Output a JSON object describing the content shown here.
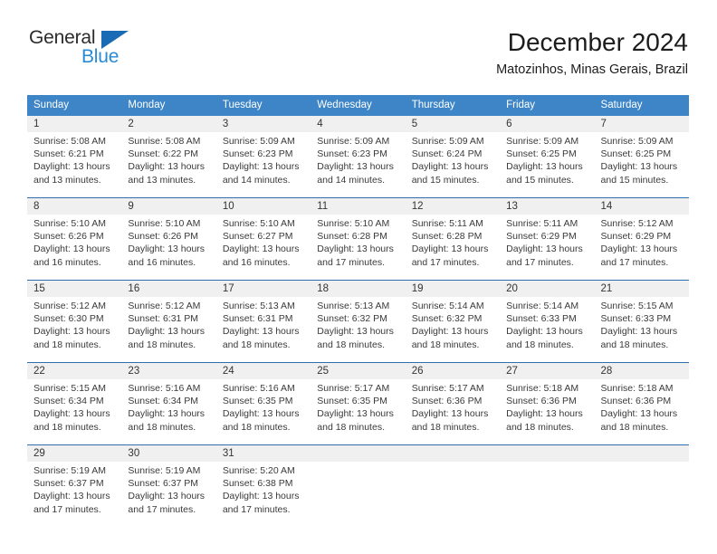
{
  "logo": {
    "word_top": "General",
    "word_bottom": "Blue",
    "triangle_icon": "triangle-icon",
    "color_dark": "#2b2b2b",
    "color_blue": "#2a8ad4",
    "color_triangle": "#1a6bb5"
  },
  "header": {
    "title": "December 2024",
    "subtitle": "Matozinhos, Minas Gerais, Brazil"
  },
  "theme": {
    "header_bg": "#3d85c6",
    "header_text": "#ffffff",
    "daynum_band_bg": "#f0f0f0",
    "row_divider": "#2f6fad"
  },
  "weekdays": [
    "Sunday",
    "Monday",
    "Tuesday",
    "Wednesday",
    "Thursday",
    "Friday",
    "Saturday"
  ],
  "weeks": [
    [
      {
        "day": "1",
        "sunrise": "Sunrise: 5:08 AM",
        "sunset": "Sunset: 6:21 PM",
        "daylight": "Daylight: 13 hours and 13 minutes."
      },
      {
        "day": "2",
        "sunrise": "Sunrise: 5:08 AM",
        "sunset": "Sunset: 6:22 PM",
        "daylight": "Daylight: 13 hours and 13 minutes."
      },
      {
        "day": "3",
        "sunrise": "Sunrise: 5:09 AM",
        "sunset": "Sunset: 6:23 PM",
        "daylight": "Daylight: 13 hours and 14 minutes."
      },
      {
        "day": "4",
        "sunrise": "Sunrise: 5:09 AM",
        "sunset": "Sunset: 6:23 PM",
        "daylight": "Daylight: 13 hours and 14 minutes."
      },
      {
        "day": "5",
        "sunrise": "Sunrise: 5:09 AM",
        "sunset": "Sunset: 6:24 PM",
        "daylight": "Daylight: 13 hours and 15 minutes."
      },
      {
        "day": "6",
        "sunrise": "Sunrise: 5:09 AM",
        "sunset": "Sunset: 6:25 PM",
        "daylight": "Daylight: 13 hours and 15 minutes."
      },
      {
        "day": "7",
        "sunrise": "Sunrise: 5:09 AM",
        "sunset": "Sunset: 6:25 PM",
        "daylight": "Daylight: 13 hours and 15 minutes."
      }
    ],
    [
      {
        "day": "8",
        "sunrise": "Sunrise: 5:10 AM",
        "sunset": "Sunset: 6:26 PM",
        "daylight": "Daylight: 13 hours and 16 minutes."
      },
      {
        "day": "9",
        "sunrise": "Sunrise: 5:10 AM",
        "sunset": "Sunset: 6:26 PM",
        "daylight": "Daylight: 13 hours and 16 minutes."
      },
      {
        "day": "10",
        "sunrise": "Sunrise: 5:10 AM",
        "sunset": "Sunset: 6:27 PM",
        "daylight": "Daylight: 13 hours and 16 minutes."
      },
      {
        "day": "11",
        "sunrise": "Sunrise: 5:10 AM",
        "sunset": "Sunset: 6:28 PM",
        "daylight": "Daylight: 13 hours and 17 minutes."
      },
      {
        "day": "12",
        "sunrise": "Sunrise: 5:11 AM",
        "sunset": "Sunset: 6:28 PM",
        "daylight": "Daylight: 13 hours and 17 minutes."
      },
      {
        "day": "13",
        "sunrise": "Sunrise: 5:11 AM",
        "sunset": "Sunset: 6:29 PM",
        "daylight": "Daylight: 13 hours and 17 minutes."
      },
      {
        "day": "14",
        "sunrise": "Sunrise: 5:12 AM",
        "sunset": "Sunset: 6:29 PM",
        "daylight": "Daylight: 13 hours and 17 minutes."
      }
    ],
    [
      {
        "day": "15",
        "sunrise": "Sunrise: 5:12 AM",
        "sunset": "Sunset: 6:30 PM",
        "daylight": "Daylight: 13 hours and 18 minutes."
      },
      {
        "day": "16",
        "sunrise": "Sunrise: 5:12 AM",
        "sunset": "Sunset: 6:31 PM",
        "daylight": "Daylight: 13 hours and 18 minutes."
      },
      {
        "day": "17",
        "sunrise": "Sunrise: 5:13 AM",
        "sunset": "Sunset: 6:31 PM",
        "daylight": "Daylight: 13 hours and 18 minutes."
      },
      {
        "day": "18",
        "sunrise": "Sunrise: 5:13 AM",
        "sunset": "Sunset: 6:32 PM",
        "daylight": "Daylight: 13 hours and 18 minutes."
      },
      {
        "day": "19",
        "sunrise": "Sunrise: 5:14 AM",
        "sunset": "Sunset: 6:32 PM",
        "daylight": "Daylight: 13 hours and 18 minutes."
      },
      {
        "day": "20",
        "sunrise": "Sunrise: 5:14 AM",
        "sunset": "Sunset: 6:33 PM",
        "daylight": "Daylight: 13 hours and 18 minutes."
      },
      {
        "day": "21",
        "sunrise": "Sunrise: 5:15 AM",
        "sunset": "Sunset: 6:33 PM",
        "daylight": "Daylight: 13 hours and 18 minutes."
      }
    ],
    [
      {
        "day": "22",
        "sunrise": "Sunrise: 5:15 AM",
        "sunset": "Sunset: 6:34 PM",
        "daylight": "Daylight: 13 hours and 18 minutes."
      },
      {
        "day": "23",
        "sunrise": "Sunrise: 5:16 AM",
        "sunset": "Sunset: 6:34 PM",
        "daylight": "Daylight: 13 hours and 18 minutes."
      },
      {
        "day": "24",
        "sunrise": "Sunrise: 5:16 AM",
        "sunset": "Sunset: 6:35 PM",
        "daylight": "Daylight: 13 hours and 18 minutes."
      },
      {
        "day": "25",
        "sunrise": "Sunrise: 5:17 AM",
        "sunset": "Sunset: 6:35 PM",
        "daylight": "Daylight: 13 hours and 18 minutes."
      },
      {
        "day": "26",
        "sunrise": "Sunrise: 5:17 AM",
        "sunset": "Sunset: 6:36 PM",
        "daylight": "Daylight: 13 hours and 18 minutes."
      },
      {
        "day": "27",
        "sunrise": "Sunrise: 5:18 AM",
        "sunset": "Sunset: 6:36 PM",
        "daylight": "Daylight: 13 hours and 18 minutes."
      },
      {
        "day": "28",
        "sunrise": "Sunrise: 5:18 AM",
        "sunset": "Sunset: 6:36 PM",
        "daylight": "Daylight: 13 hours and 18 minutes."
      }
    ],
    [
      {
        "day": "29",
        "sunrise": "Sunrise: 5:19 AM",
        "sunset": "Sunset: 6:37 PM",
        "daylight": "Daylight: 13 hours and 17 minutes."
      },
      {
        "day": "30",
        "sunrise": "Sunrise: 5:19 AM",
        "sunset": "Sunset: 6:37 PM",
        "daylight": "Daylight: 13 hours and 17 minutes."
      },
      {
        "day": "31",
        "sunrise": "Sunrise: 5:20 AM",
        "sunset": "Sunset: 6:38 PM",
        "daylight": "Daylight: 13 hours and 17 minutes."
      },
      {
        "day": "",
        "sunrise": "",
        "sunset": "",
        "daylight": ""
      },
      {
        "day": "",
        "sunrise": "",
        "sunset": "",
        "daylight": ""
      },
      {
        "day": "",
        "sunrise": "",
        "sunset": "",
        "daylight": ""
      },
      {
        "day": "",
        "sunrise": "",
        "sunset": "",
        "daylight": ""
      }
    ]
  ]
}
